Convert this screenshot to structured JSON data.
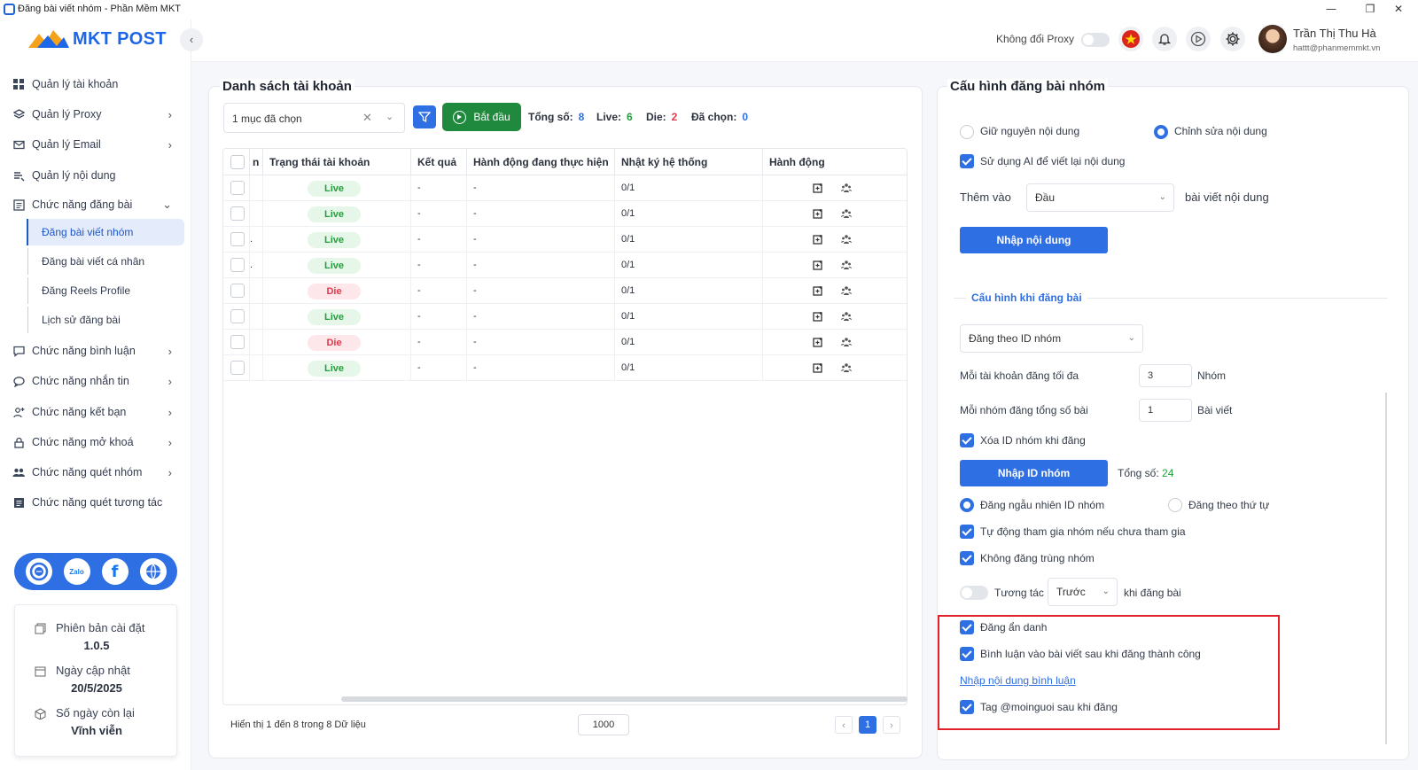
{
  "window": {
    "title": "Đăng bài viết nhóm - Phần Mềm MKT",
    "minimize": "—",
    "restore": "❐",
    "close": "✕"
  },
  "brand": {
    "logo_text": "MKT POST",
    "accent": "#1e66e8"
  },
  "sidebar": {
    "items": [
      {
        "label": "Quản lý tài khoản",
        "icon": "dashboard-icon",
        "has_children": false
      },
      {
        "label": "Quản lý Proxy",
        "icon": "layers-icon",
        "has_children": true
      },
      {
        "label": "Quản lý Email",
        "icon": "mail-icon",
        "has_children": true
      },
      {
        "label": "Quản lý nội dung",
        "icon": "content-icon",
        "has_children": false
      },
      {
        "label": "Chức năng đăng bài",
        "icon": "post-icon",
        "has_children": true,
        "expanded": true
      }
    ],
    "subitems": [
      {
        "label": "Đăng bài viết nhóm",
        "active": true
      },
      {
        "label": "Đăng bài viết cá nhân",
        "active": false
      },
      {
        "label": "Đăng Reels Profile",
        "active": false
      },
      {
        "label": "Lịch sử đăng bài",
        "active": false
      }
    ],
    "items2": [
      {
        "label": "Chức năng bình luận",
        "icon": "comment-icon",
        "has_children": true
      },
      {
        "label": "Chức năng nhắn tin",
        "icon": "chat-icon",
        "has_children": true
      },
      {
        "label": "Chức năng kết bạn",
        "icon": "add-friend-icon",
        "has_children": true
      },
      {
        "label": "Chức năng mở khoá",
        "icon": "lock-icon",
        "has_children": true
      },
      {
        "label": "Chức năng quét nhóm",
        "icon": "group-icon",
        "has_children": true
      },
      {
        "label": "Chức năng quét tương tác",
        "icon": "scan-icon",
        "has_children": false
      }
    ],
    "social": {
      "zalo": "Zalo"
    },
    "info": {
      "version_label": "Phiên bản cài đặt",
      "version_value": "1.0.5",
      "update_label": "Ngày cập nhật",
      "update_value": "20/5/2025",
      "days_label": "Số ngày còn lại",
      "days_value": "Vĩnh viễn"
    }
  },
  "header": {
    "proxy_label": "Không đổi Proxy",
    "proxy_on": false,
    "user_name": "Trần Thị Thu Hà",
    "user_email": "hattt@phanmemmkt.vn"
  },
  "accounts": {
    "title": "Danh sách tài khoản",
    "selected_text": "1 mục đã chọn",
    "start_label": "Bắt đầu",
    "total_label": "Tổng số:",
    "total_value": "8",
    "live_label": "Live:",
    "live_value": "6",
    "die_label": "Die:",
    "die_value": "2",
    "selected_label": "Đã chọn:",
    "selected_value": "0",
    "columns": [
      "n",
      "Trạng thái tài khoản",
      "Kết quả",
      "Hành động đang thực hiện",
      "Nhật ký hệ thống",
      "Hành động"
    ],
    "rows": [
      {
        "status": "Live",
        "result": "-",
        "action": "-",
        "log": "0/1",
        "mark": ""
      },
      {
        "status": "Live",
        "result": "-",
        "action": "-",
        "log": "0/1",
        "mark": ""
      },
      {
        "status": "Live",
        "result": "-",
        "action": "-",
        "log": "0/1",
        "mark": "."
      },
      {
        "status": "Live",
        "result": "-",
        "action": "-",
        "log": "0/1",
        "mark": "."
      },
      {
        "status": "Die",
        "result": "-",
        "action": "-",
        "log": "0/1",
        "mark": ""
      },
      {
        "status": "Live",
        "result": "-",
        "action": "-",
        "log": "0/1",
        "mark": ""
      },
      {
        "status": "Die",
        "result": "-",
        "action": "-",
        "log": "0/1",
        "mark": ""
      },
      {
        "status": "Live",
        "result": "-",
        "action": "-",
        "log": "0/1",
        "mark": ""
      }
    ],
    "footer_text": "Hiển thị 1 đến 8 trong 8 Dữ liệu",
    "page_size": "1000",
    "current_page": "1",
    "prev": "‹",
    "next": "›",
    "status_colors": {
      "live": "#22a03c",
      "die": "#e0384c"
    }
  },
  "config": {
    "title": "Cấu hình đăng bài nhóm",
    "keep_content": "Giữ nguyên nội dung",
    "edit_content": "Chỉnh sửa nội dung",
    "use_ai": "Sử dụng AI để viết lại nội dung",
    "add_label": "Thêm vào",
    "add_position": "Đầu",
    "add_suffix": "bài viết nội dung",
    "input_content": "Nhập nội dung",
    "section_title": "Cấu hình khi đăng bài",
    "post_by": "Đăng theo ID nhóm",
    "max_per_account_label": "Mỗi tài khoản đăng tối đa",
    "max_per_account_value": "3",
    "max_per_account_unit": "Nhóm",
    "posts_per_group_label": "Mỗi nhóm đăng tổng số bài",
    "posts_per_group_value": "1",
    "posts_per_group_unit": "Bài viết",
    "delete_id": "Xóa ID nhóm khi đăng",
    "input_group_id": "Nhập ID nhóm",
    "total_label": "Tổng số:",
    "total_value": "24",
    "random_order": "Đăng ngẫu nhiên ID nhóm",
    "seq_order": "Đăng theo thứ tự",
    "auto_join": "Tự động tham gia nhóm nếu chưa tham gia",
    "no_duplicate": "Không đăng trùng nhóm",
    "interact_label": "Tương tác",
    "interact_when": "Trước",
    "interact_suffix": "khi đăng bài",
    "anonymous": "Đăng ẩn danh",
    "comment_after": "Bình luận vào bài viết sau khi đăng thành công",
    "input_comment": "Nhập nội dung bình luận",
    "tag_all": "Tag @moinguoi sau khi đăng"
  }
}
